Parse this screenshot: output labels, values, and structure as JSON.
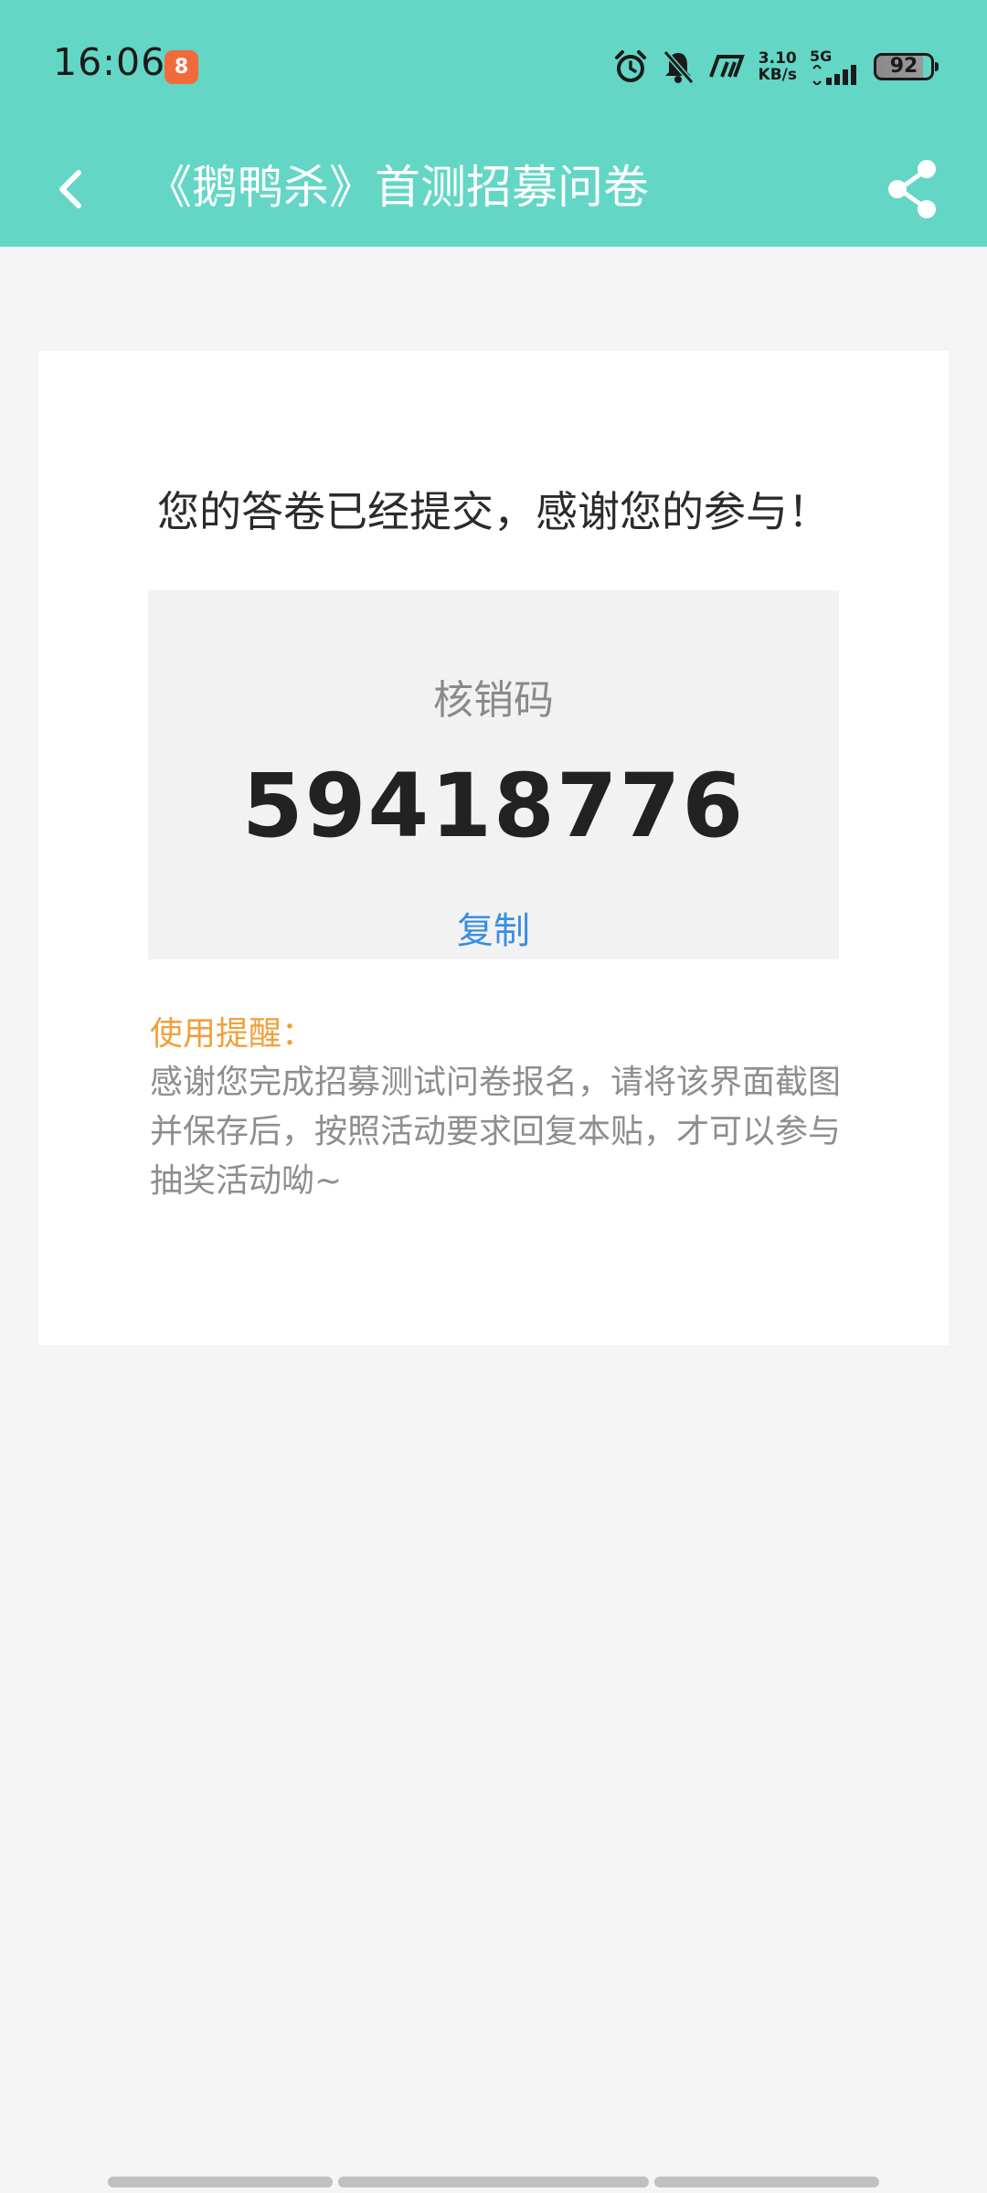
{
  "status_bar": {
    "time": "16:06",
    "app_badge": "ꕥ",
    "net_speed_value": "3.10",
    "net_speed_unit": "KB/s",
    "network_type": "5G",
    "battery_level": "92",
    "icons": [
      "alarm-icon",
      "mute-bell-icon",
      "nfc-icon",
      "signal-icon"
    ]
  },
  "nav": {
    "title": "《鹅鸭杀》首测招募问卷",
    "back_icon": "chevron-left-icon",
    "share_icon": "share-icon"
  },
  "result": {
    "headline": "您的答卷已经提交，感谢您的参与！",
    "code_label": "核销码",
    "code_value": "59418776",
    "copy_label": "复制",
    "tip_title": "使用提醒：",
    "tip_body": "感谢您完成招募测试问卷报名，请将该界面截图并保存后，按照活动要求回复本贴，才可以参与抽奖活动呦~"
  },
  "colors": {
    "header": "#63d6c6",
    "accent_link": "#3a8ee0",
    "tip_title": "#f0a03a",
    "background": "#f5f5f5"
  }
}
